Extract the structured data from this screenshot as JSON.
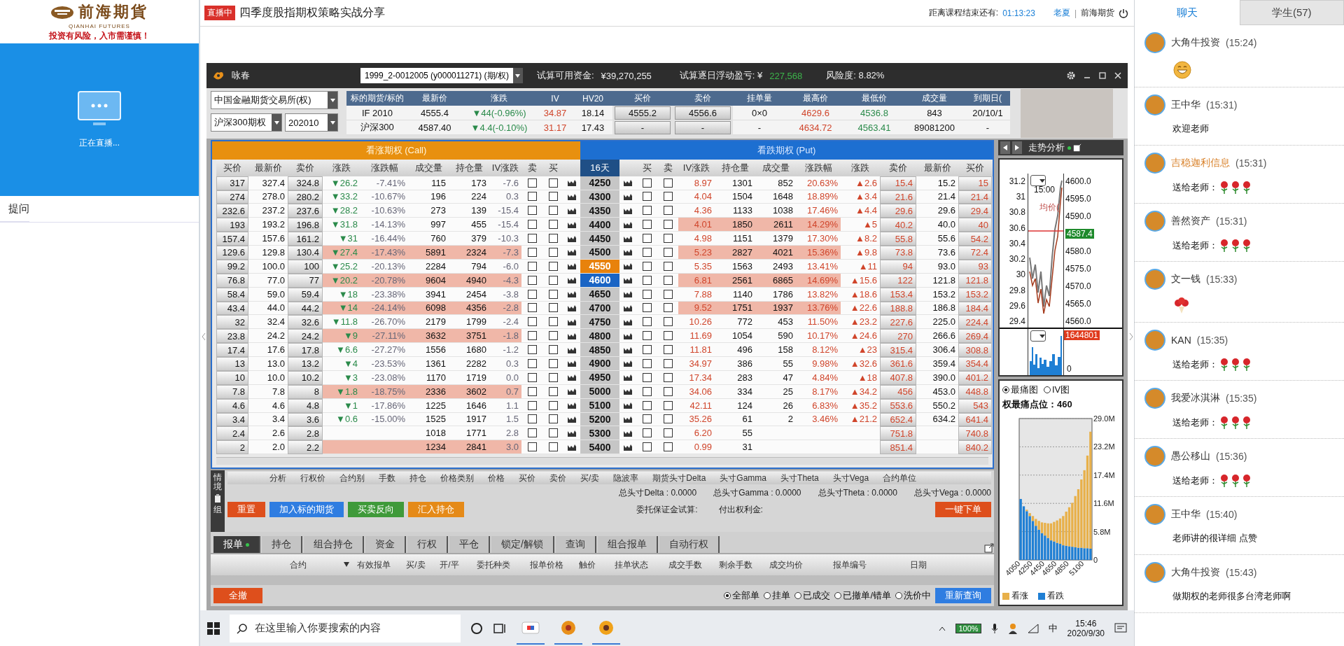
{
  "sidebar": {
    "logo_name": "前海期貨",
    "logo_english": "QIANHAI FUTURES",
    "logo_slogan": "投资有风险，入市需谨慎！",
    "live_status": "正在直播...",
    "question_tab": "提问"
  },
  "header": {
    "live_badge": "直播中",
    "course_title": "四季度股指期权策略实战分享",
    "countdown_label": "距离课程结束还有:",
    "countdown": "01:13:23",
    "teacher": "老夏",
    "separator": "|",
    "organization": "前海期货"
  },
  "trade_window": {
    "app_name": "咏春",
    "account": "1999_2-0012005 (y000011271) (期/权)",
    "funds_label": "试算可用资金:",
    "funds": "¥39,270,255",
    "pnl_label": "试算逐日浮动盈亏: ¥",
    "pnl": "227,568",
    "risk": "风险度: 8.82%",
    "exchange": "中国金融期货交易所(权)",
    "product": "沪深300期权",
    "month": "202010",
    "underlying_columns": [
      "标的期货/标的",
      "最新价",
      "涨跌",
      "IV",
      "HV20",
      "买价",
      "卖价",
      "挂单量",
      "最高价",
      "最低价",
      "成交量",
      "到期日("
    ],
    "underlying_rows": [
      {
        "cells": [
          "IF 2010",
          "4555.4",
          "▼44(-0.96%)",
          "34.87",
          "18.14",
          "4555.2",
          "4556.6",
          "0×0",
          "4629.6",
          "4536.8",
          "843",
          "20/10/1"
        ]
      },
      {
        "cells": [
          "沪深300",
          "4587.40",
          "▼4.4(-0.10%)",
          "31.17",
          "17.43",
          "-",
          "-",
          "-",
          "4634.72",
          "4563.41",
          "89081200",
          "-"
        ]
      }
    ],
    "call_title": "看涨期权 (Call)",
    "put_title": "看跌期权 (Put)",
    "call_columns": [
      "买价",
      "最新价",
      "卖价",
      "涨跌",
      "涨跌幅",
      "成交量",
      "持仓量",
      "IV涨跌",
      "卖",
      "买"
    ],
    "strike_header": "16天",
    "put_columns": [
      "买",
      "卖",
      "IV涨跌",
      "持仓量",
      "成交量",
      "涨跌幅",
      "涨跌",
      "卖价",
      "最新价",
      "买价"
    ],
    "rows": [
      {
        "strike": "4250",
        "atm": false,
        "selected": false,
        "call_hot": false,
        "put_hot": false,
        "call_sell": false,
        "call_buy": false,
        "put_buy": false,
        "put_sell": false,
        "call": {
          "bid": "317",
          "last": "327.4",
          "ask": "324.8",
          "change": "▼26.2",
          "change_pct": "-7.41%",
          "volume": "115",
          "open_interest": "173",
          "iv_change": "-7.6"
        },
        "put": {
          "iv_change": "8.97",
          "open_interest": "1301",
          "volume": "852",
          "change_pct": "20.63%",
          "change": "▲2.6",
          "ask": "15.4",
          "last": "15.2",
          "bid": "15"
        }
      },
      {
        "strike": "4300",
        "atm": false,
        "selected": false,
        "call_hot": false,
        "put_hot": false,
        "call_sell": false,
        "call_buy": false,
        "put_buy": false,
        "put_sell": false,
        "call": {
          "bid": "274",
          "last": "278.0",
          "ask": "280.2",
          "change": "▼33.2",
          "change_pct": "-10.67%",
          "volume": "196",
          "open_interest": "224",
          "iv_change": "0.3"
        },
        "put": {
          "iv_change": "4.04",
          "open_interest": "1504",
          "volume": "1648",
          "change_pct": "18.89%",
          "change": "▲3.4",
          "ask": "21.6",
          "last": "21.4",
          "bid": "21.4"
        }
      },
      {
        "strike": "4350",
        "atm": false,
        "selected": false,
        "call_hot": false,
        "put_hot": false,
        "call_sell": false,
        "call_buy": false,
        "put_buy": false,
        "put_sell": false,
        "call": {
          "bid": "232.6",
          "last": "237.2",
          "ask": "237.6",
          "change": "▼28.2",
          "change_pct": "-10.63%",
          "volume": "273",
          "open_interest": "139",
          "iv_change": "-15.4"
        },
        "put": {
          "iv_change": "4.36",
          "open_interest": "1133",
          "volume": "1038",
          "change_pct": "17.46%",
          "change": "▲4.4",
          "ask": "29.6",
          "last": "29.6",
          "bid": "29.4"
        }
      },
      {
        "strike": "4400",
        "atm": false,
        "selected": false,
        "call_hot": false,
        "put_hot": true,
        "call_sell": false,
        "call_buy": false,
        "put_buy": false,
        "put_sell": false,
        "call": {
          "bid": "193",
          "last": "193.2",
          "ask": "196.8",
          "change": "▼31.8",
          "change_pct": "-14.13%",
          "volume": "997",
          "open_interest": "455",
          "iv_change": "-15.4"
        },
        "put": {
          "iv_change": "4.01",
          "open_interest": "1850",
          "volume": "2611",
          "change_pct": "14.29%",
          "change": "▲5",
          "ask": "40.2",
          "last": "40.0",
          "bid": "40"
        }
      },
      {
        "strike": "4450",
        "atm": false,
        "selected": false,
        "call_hot": false,
        "put_hot": false,
        "call_sell": false,
        "call_buy": false,
        "put_buy": false,
        "put_sell": false,
        "call": {
          "bid": "157.4",
          "last": "157.6",
          "ask": "161.2",
          "change": "▼31",
          "change_pct": "-16.44%",
          "volume": "760",
          "open_interest": "379",
          "iv_change": "-10.3"
        },
        "put": {
          "iv_change": "4.98",
          "open_interest": "1151",
          "volume": "1379",
          "change_pct": "17.30%",
          "change": "▲8.2",
          "ask": "55.8",
          "last": "55.6",
          "bid": "54.2"
        }
      },
      {
        "strike": "4500",
        "atm": false,
        "selected": false,
        "call_hot": true,
        "put_hot": true,
        "call_sell": false,
        "call_buy": false,
        "put_buy": false,
        "put_sell": false,
        "call": {
          "bid": "129.6",
          "last": "129.8",
          "ask": "130.4",
          "change": "▼27.4",
          "change_pct": "-17.43%",
          "volume": "5891",
          "open_interest": "2324",
          "iv_change": "-7.3"
        },
        "put": {
          "iv_change": "5.23",
          "open_interest": "2827",
          "volume": "4021",
          "change_pct": "15.36%",
          "change": "▲9.8",
          "ask": "73.8",
          "last": "73.6",
          "bid": "72.4"
        }
      },
      {
        "strike": "4550",
        "atm": true,
        "selected": false,
        "call_hot": false,
        "put_hot": false,
        "call_sell": false,
        "call_buy": false,
        "put_buy": false,
        "put_sell": false,
        "call": {
          "bid": "99.2",
          "last": "100.0",
          "ask": "100",
          "change": "▼25.2",
          "change_pct": "-20.13%",
          "volume": "2284",
          "open_interest": "794",
          "iv_change": "-6.0"
        },
        "put": {
          "iv_change": "5.35",
          "open_interest": "1563",
          "volume": "2493",
          "change_pct": "13.41%",
          "change": "▲11",
          "ask": "94",
          "last": "93.0",
          "bid": "93"
        }
      },
      {
        "strike": "4600",
        "atm": false,
        "selected": true,
        "call_hot": true,
        "put_hot": true,
        "call_sell": false,
        "call_buy": false,
        "put_buy": false,
        "put_sell": false,
        "call": {
          "bid": "76.8",
          "last": "77.0",
          "ask": "77",
          "change": "▼20.2",
          "change_pct": "-20.78%",
          "volume": "9604",
          "open_interest": "4940",
          "iv_change": "-4.3"
        },
        "put": {
          "iv_change": "6.81",
          "open_interest": "2561",
          "volume": "6865",
          "change_pct": "14.69%",
          "change": "▲15.6",
          "ask": "122",
          "last": "121.8",
          "bid": "121.8"
        }
      },
      {
        "strike": "4650",
        "atm": false,
        "selected": false,
        "call_hot": false,
        "put_hot": false,
        "call_sell": false,
        "call_buy": false,
        "put_buy": false,
        "put_sell": false,
        "call": {
          "bid": "58.4",
          "last": "59.0",
          "ask": "59.4",
          "change": "▼18",
          "change_pct": "-23.38%",
          "volume": "3941",
          "open_interest": "2454",
          "iv_change": "-3.8"
        },
        "put": {
          "iv_change": "7.88",
          "open_interest": "1140",
          "volume": "1786",
          "change_pct": "13.82%",
          "change": "▲18.6",
          "ask": "153.4",
          "last": "153.2",
          "bid": "153.2"
        }
      },
      {
        "strike": "4700",
        "atm": false,
        "selected": false,
        "call_hot": true,
        "put_hot": true,
        "call_sell": false,
        "call_buy": false,
        "put_buy": false,
        "put_sell": false,
        "call": {
          "bid": "43.4",
          "last": "44.0",
          "ask": "44.2",
          "change": "▼14",
          "change_pct": "-24.14%",
          "volume": "6098",
          "open_interest": "4356",
          "iv_change": "-2.8"
        },
        "put": {
          "iv_change": "9.52",
          "open_interest": "1751",
          "volume": "1937",
          "change_pct": "13.76%",
          "change": "▲22.6",
          "ask": "188.8",
          "last": "186.8",
          "bid": "184.4"
        }
      },
      {
        "strike": "4750",
        "atm": false,
        "selected": false,
        "call_hot": false,
        "put_hot": false,
        "call_sell": false,
        "call_buy": false,
        "put_buy": false,
        "put_sell": false,
        "call": {
          "bid": "32",
          "last": "32.4",
          "ask": "32.6",
          "change": "▼11.8",
          "change_pct": "-26.70%",
          "volume": "2179",
          "open_interest": "1799",
          "iv_change": "-2.4"
        },
        "put": {
          "iv_change": "10.26",
          "open_interest": "772",
          "volume": "453",
          "change_pct": "11.50%",
          "change": "▲23.2",
          "ask": "227.6",
          "last": "225.0",
          "bid": "224.4"
        }
      },
      {
        "strike": "4800",
        "atm": false,
        "selected": false,
        "call_hot": true,
        "put_hot": false,
        "call_sell": false,
        "call_buy": false,
        "put_buy": false,
        "put_sell": false,
        "call": {
          "bid": "23.8",
          "last": "24.2",
          "ask": "24.2",
          "change": "▼9",
          "change_pct": "-27.11%",
          "volume": "3632",
          "open_interest": "3751",
          "iv_change": "-1.8"
        },
        "put": {
          "iv_change": "11.69",
          "open_interest": "1054",
          "volume": "590",
          "change_pct": "10.17%",
          "change": "▲24.6",
          "ask": "270",
          "last": "266.6",
          "bid": "269.4"
        }
      },
      {
        "strike": "4850",
        "atm": false,
        "selected": false,
        "call_hot": false,
        "put_hot": false,
        "call_sell": false,
        "call_buy": false,
        "put_buy": false,
        "put_sell": false,
        "call": {
          "bid": "17.4",
          "last": "17.6",
          "ask": "17.8",
          "change": "▼6.6",
          "change_pct": "-27.27%",
          "volume": "1556",
          "open_interest": "1680",
          "iv_change": "-1.2"
        },
        "put": {
          "iv_change": "11.81",
          "open_interest": "496",
          "volume": "158",
          "change_pct": "8.12%",
          "change": "▲23",
          "ask": "315.4",
          "last": "306.4",
          "bid": "308.8"
        }
      },
      {
        "strike": "4900",
        "atm": false,
        "selected": false,
        "call_hot": false,
        "put_hot": false,
        "call_sell": false,
        "call_buy": false,
        "put_buy": false,
        "put_sell": false,
        "call": {
          "bid": "13",
          "last": "13.0",
          "ask": "13.2",
          "change": "▼4",
          "change_pct": "-23.53%",
          "volume": "1361",
          "open_interest": "2282",
          "iv_change": "0.3"
        },
        "put": {
          "iv_change": "34.97",
          "open_interest": "386",
          "volume": "55",
          "change_pct": "9.98%",
          "change": "▲32.6",
          "ask": "361.6",
          "last": "359.4",
          "bid": "354.4"
        }
      },
      {
        "strike": "4950",
        "atm": false,
        "selected": false,
        "call_hot": false,
        "put_hot": false,
        "call_sell": false,
        "call_buy": false,
        "put_buy": false,
        "put_sell": false,
        "call": {
          "bid": "10",
          "last": "10.0",
          "ask": "10.2",
          "change": "▼3",
          "change_pct": "-23.08%",
          "volume": "1170",
          "open_interest": "1719",
          "iv_change": "0.0"
        },
        "put": {
          "iv_change": "17.34",
          "open_interest": "283",
          "volume": "47",
          "change_pct": "4.84%",
          "change": "▲18",
          "ask": "407.8",
          "last": "390.0",
          "bid": "401.2"
        }
      },
      {
        "strike": "5000",
        "atm": false,
        "selected": false,
        "call_hot": true,
        "put_hot": false,
        "call_sell": false,
        "call_buy": false,
        "put_buy": false,
        "put_sell": false,
        "call": {
          "bid": "7.8",
          "last": "7.8",
          "ask": "8",
          "change": "▼1.8",
          "change_pct": "-18.75%",
          "volume": "2336",
          "open_interest": "3602",
          "iv_change": "0.7"
        },
        "put": {
          "iv_change": "34.06",
          "open_interest": "334",
          "volume": "25",
          "change_pct": "8.17%",
          "change": "▲34.2",
          "ask": "456",
          "last": "453.0",
          "bid": "448.8"
        }
      },
      {
        "strike": "5100",
        "atm": false,
        "selected": false,
        "call_hot": false,
        "put_hot": false,
        "call_sell": false,
        "call_buy": false,
        "put_buy": false,
        "put_sell": false,
        "call": {
          "bid": "4.6",
          "last": "4.6",
          "ask": "4.8",
          "change": "▼1",
          "change_pct": "-17.86%",
          "volume": "1225",
          "open_interest": "1646",
          "iv_change": "1.1"
        },
        "put": {
          "iv_change": "42.11",
          "open_interest": "124",
          "volume": "26",
          "change_pct": "6.83%",
          "change": "▲35.2",
          "ask": "553.6",
          "last": "550.2",
          "bid": "543"
        }
      },
      {
        "strike": "5200",
        "atm": false,
        "selected": false,
        "call_hot": false,
        "put_hot": false,
        "call_sell": false,
        "call_buy": false,
        "put_buy": false,
        "put_sell": false,
        "call": {
          "bid": "3.4",
          "last": "3.4",
          "ask": "3.6",
          "change": "▼0.6",
          "change_pct": "-15.00%",
          "volume": "1525",
          "open_interest": "1917",
          "iv_change": "1.5"
        },
        "put": {
          "iv_change": "35.26",
          "open_interest": "61",
          "volume": "2",
          "change_pct": "3.46%",
          "change": "▲21.2",
          "ask": "652.4",
          "last": "634.2",
          "bid": "641.4"
        }
      },
      {
        "strike": "5300",
        "atm": false,
        "selected": false,
        "call_hot": false,
        "put_hot": false,
        "call_sell": false,
        "call_buy": false,
        "put_buy": false,
        "put_sell": false,
        "call": {
          "bid": "2.4",
          "last": "2.6",
          "ask": "2.8",
          "volume": "1018",
          "open_interest": "1771",
          "iv_change": "2.8"
        },
        "put": {
          "iv_change": "6.20",
          "open_interest": "55",
          "ask": "751.8",
          "bid": "740.8"
        }
      },
      {
        "strike": "5400",
        "atm": false,
        "selected": false,
        "call_hot": true,
        "put_hot": false,
        "call_sell": false,
        "call_buy": false,
        "put_buy": false,
        "put_sell": false,
        "call": {
          "bid": "2",
          "last": "2.0",
          "ask": "2.2",
          "volume": "1234",
          "open_interest": "2841",
          "iv_change": "3.0"
        },
        "put": {
          "iv_change": "0.99",
          "open_interest": "31",
          "ask": "851.4",
          "bid": "840.2"
        }
      }
    ]
  },
  "trend_panel": {
    "tab": "走势分析",
    "left_ticks": [
      "31.2",
      "31",
      "30.8",
      "30.6",
      "30.4",
      "30.2",
      "30",
      "29.8",
      "29.6",
      "29.4"
    ],
    "right_ticks": [
      "4600.0",
      "4595.0",
      "4590.0",
      "4580.0",
      "4575.0",
      "4570.0",
      "4565.0",
      "4560.0"
    ],
    "time_label": "15:00",
    "avg_label": "均价(",
    "price_tag": "4587.4",
    "volume_tag": "1644801",
    "volume_zero": "0",
    "modes": [
      {
        "label": "最痛图",
        "selected": true
      },
      {
        "label": "IV图",
        "selected": false
      }
    ],
    "max_pain": "权最痛点位：460",
    "chart_data": {
      "type": "bar",
      "stacked": true,
      "grid": true,
      "x": [
        4050,
        4100,
        4150,
        4200,
        4250,
        4300,
        4350,
        4400,
        4450,
        4500,
        4550,
        4600,
        4650,
        4700,
        4750,
        4800,
        4850,
        4900,
        4950,
        5000,
        5050,
        5100,
        5150,
        5200
      ],
      "series": [
        {
          "name": "看涨",
          "color": "#e8b04a",
          "values": [
            0,
            null,
            300000,
            600000,
            1000000,
            1400000,
            1800000,
            2200000,
            2600000,
            3000000,
            3500000,
            4000000,
            4600000,
            5200000,
            6000000,
            7000000,
            8000000,
            9000000,
            10500000,
            12000000,
            14000000,
            16000000,
            19000000,
            24000000
          ]
        },
        {
          "name": "看跌",
          "color": "#1f7fd4",
          "values": [
            12500000,
            11000000,
            10000000,
            9000000,
            8000000,
            7000000,
            6200000,
            5500000,
            5000000,
            4500000,
            4000000,
            3800000,
            3500000,
            3300000,
            3000000,
            2900000,
            2800000,
            2700000,
            2600000,
            2500000,
            2500000,
            2400000,
            2400000,
            2300000
          ]
        }
      ],
      "ylim": [
        0,
        29000000
      ],
      "yticks": [
        {
          "value": 0,
          "label": "0"
        },
        {
          "value": 5800000,
          "label": "5.8M"
        },
        {
          "value": 11600000,
          "label": "11.6M"
        },
        {
          "value": 17400000,
          "label": "17.4M"
        },
        {
          "value": 23200000,
          "label": "23.2M"
        },
        {
          "value": 29000000,
          "label": "29.0M"
        }
      ],
      "xlim": [
        4025,
        5225
      ],
      "xticks": [
        4050,
        4250,
        4450,
        4650,
        4850,
        5100
      ]
    }
  },
  "strategy": {
    "side_tabs": [
      "情境",
      "组"
    ],
    "columns": [
      "分析",
      "行权价",
      "合约别",
      "手数",
      "持仓",
      "价格类别",
      "价格",
      "买价",
      "卖价",
      "买/卖",
      "隐波率",
      "期货头寸Delta",
      "头寸Gamma",
      "头寸Theta",
      "头寸Vega",
      "合约单位"
    ],
    "totals": [
      "总头寸Delta : 0.0000",
      "总头寸Gamma : 0.0000",
      "总头寸Theta : 0.0000",
      "总头寸Vega : 0.0000"
    ],
    "buttons": [
      {
        "label": "重置",
        "kind": "reset"
      },
      {
        "label": "加入标的期货",
        "kind": "add"
      },
      {
        "label": "买卖反向",
        "kind": "reverse"
      },
      {
        "label": "汇入持仓",
        "kind": "import"
      }
    ],
    "margin_label": "委托保证金试算:",
    "premium_label": "付出权利金:",
    "submit": "一键下单"
  },
  "orders": {
    "tabs": [
      {
        "label": "报单",
        "selected": true
      },
      {
        "label": "持仓",
        "selected": false
      },
      {
        "label": "组合持仓",
        "selected": false
      },
      {
        "label": "资金",
        "selected": false
      },
      {
        "label": "行权",
        "selected": false
      },
      {
        "label": "平仓",
        "selected": false
      },
      {
        "label": "锁定/解锁",
        "selected": false
      },
      {
        "label": "查询",
        "selected": false
      },
      {
        "label": "组合报单",
        "selected": false
      },
      {
        "label": "自动行权",
        "selected": false
      }
    ],
    "columns": [
      "合约",
      "有效报单",
      "买/卖",
      "开/平",
      "委托种类",
      "报单价格",
      "触价",
      "挂单状态",
      "成交手数",
      "剩余手数",
      "成交均价",
      "报单编号",
      "日期"
    ],
    "cancel_all": "全撤",
    "filters": [
      {
        "label": "全部单",
        "selected": true
      },
      {
        "label": "挂单",
        "selected": false
      },
      {
        "label": "已成交",
        "selected": false
      },
      {
        "label": "已撤单/错单",
        "selected": false
      },
      {
        "label": "洗价中",
        "selected": false
      }
    ],
    "requery": "重新查询"
  },
  "taskbar": {
    "search_placeholder": "在这里输入你要搜索的内容",
    "battery": "100%",
    "ime": "中",
    "time": "15:46",
    "date": "2020/9/30"
  },
  "chat": {
    "tabs": [
      {
        "label": "聊天",
        "selected": true
      },
      {
        "label": "学生(57)",
        "selected": false
      }
    ],
    "messages": [
      {
        "name": "大角牛投资",
        "time": "(15:24)",
        "kind": "emoji",
        "color": "#333333"
      },
      {
        "name": "王中华",
        "time": "(15:31)",
        "kind": "text",
        "text": "欢迎老师",
        "color": "#333333"
      },
      {
        "name": "吉稳迦利信息",
        "time": "(15:31)",
        "kind": "roses",
        "text": "送给老师：",
        "color": "#d9822b"
      },
      {
        "name": "善然资产",
        "time": "(15:31)",
        "kind": "roses",
        "text": "送给老师：",
        "color": "#333333"
      },
      {
        "name": "文一钱",
        "time": "(15:33)",
        "kind": "bouquet",
        "color": "#333333"
      },
      {
        "name": "KAN",
        "time": "(15:35)",
        "kind": "roses",
        "text": "送给老师：",
        "color": "#333333"
      },
      {
        "name": "我爱冰淇淋",
        "time": "(15:35)",
        "kind": "roses",
        "text": "送给老师：",
        "color": "#333333"
      },
      {
        "name": "愚公移山",
        "time": "(15:36)",
        "kind": "roses",
        "text": "送给老师：",
        "color": "#333333"
      },
      {
        "name": "王中华",
        "time": "(15:40)",
        "kind": "text",
        "text": "老师讲的很详细 点赞",
        "color": "#333333"
      },
      {
        "name": "大角牛投资",
        "time": "(15:43)",
        "kind": "text",
        "text": "做期权的老师很多台湾老师啊",
        "color": "#333333"
      }
    ]
  }
}
